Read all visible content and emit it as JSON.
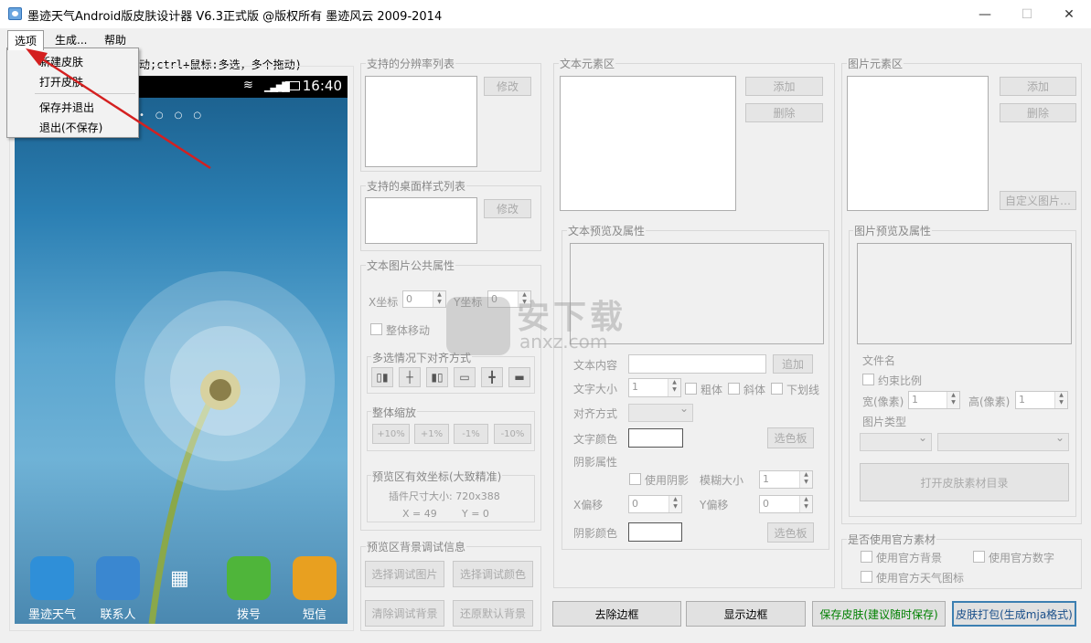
{
  "window": {
    "title": "墨迹天气Android版皮肤设计器 V6.3正式版 @版权所有 墨迹风云 2009-2014",
    "minimize": "—",
    "maximize": "☐",
    "close": "✕"
  },
  "menu": {
    "options": "选项",
    "generate": "生成...",
    "help": "帮助"
  },
  "dropdown": {
    "new_skin": "新建皮肤",
    "open_skin": "打开皮肤",
    "save_exit": "保存并退出",
    "exit_nosave": "退出(不保存)"
  },
  "preview": {
    "hint": "动;ctrl+鼠标:多选，多个拖动)",
    "clock": "16:40",
    "dock": [
      "墨迹天气",
      "联系人",
      "",
      "拨号",
      "短信"
    ]
  },
  "resolution": {
    "title": "支持的分辨率列表",
    "modify": "修改"
  },
  "desktop_style": {
    "title": "支持的桌面样式列表",
    "modify": "修改"
  },
  "common_props": {
    "title": "文本图片公共属性",
    "x_label": "X坐标",
    "x_value": "0",
    "y_label": "Y坐标",
    "y_value": "0",
    "move_all": "整体移动",
    "align_title": "多选情况下对齐方式",
    "scale_title": "整体缩放",
    "scale_buttons": [
      "+10%",
      "+1%",
      "-1%",
      "-10%"
    ],
    "coord_title": "预览区有效坐标(大致精准)",
    "plugin_size": "插件尺寸大小: 720x388",
    "x_coord": "X = 49",
    "y_coord": "Y = 0"
  },
  "bg_debug": {
    "title": "预览区背景调试信息",
    "choose_image": "选择调试图片",
    "choose_color": "选择调试颜色",
    "clear_bg": "清除调试背景",
    "restore_bg": "还原默认背景"
  },
  "text_elements": {
    "title": "文本元素区",
    "add": "添加",
    "delete": "删除",
    "preview_title": "文本预览及属性",
    "content_label": "文本内容",
    "content_add": "追加",
    "size_label": "文字大小",
    "size_value": "1",
    "bold": "粗体",
    "italic": "斜体",
    "underline": "下划线",
    "align_label": "对齐方式",
    "color_label": "文字颜色",
    "palette": "选色板",
    "shadow_title": "阴影属性",
    "use_shadow": "使用阴影",
    "blur_label": "模糊大小",
    "blur_value": "1",
    "xoff_label": "X偏移",
    "xoff_value": "0",
    "yoff_label": "Y偏移",
    "yoff_value": "0",
    "shadow_color_label": "阴影颜色",
    "shadow_palette": "选色板"
  },
  "image_elements": {
    "title": "图片元素区",
    "add": "添加",
    "delete": "删除",
    "custom": "自定义图片…",
    "preview_title": "图片预览及属性",
    "filename_label": "文件名",
    "keep_ratio": "约束比例",
    "width_label": "宽(像素)",
    "width_value": "1",
    "height_label": "高(像素)",
    "height_value": "1",
    "type_label": "图片类型",
    "open_dir": "打开皮肤素材目录"
  },
  "official": {
    "title": "是否使用官方素材",
    "bg": "使用官方背景",
    "digits": "使用官方数字",
    "weather_icon": "使用官方天气图标"
  },
  "bottom": {
    "remove_border": "去除边框",
    "show_border": "显示边框",
    "save_skin": "保存皮肤(建议随时保存)",
    "pack_skin": "皮肤打包(生成mja格式)"
  },
  "watermark": {
    "text": "安下载",
    "sub": "anxz.com"
  },
  "colors": {
    "save_text": "#008000",
    "pack_border": "#3c7fb1",
    "arrow": "#d42020"
  }
}
